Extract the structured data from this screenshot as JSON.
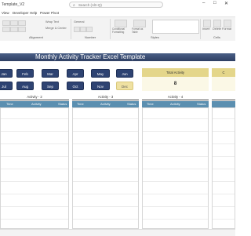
{
  "titlebar": {
    "file_title": "Template_V2",
    "search_placeholder": "Search (Alt+Q)",
    "minimize": "–",
    "maximize": "□",
    "close": "✕"
  },
  "menu": [
    "View",
    "Developer",
    "Help",
    "Power Pivot"
  ],
  "ribbon": {
    "groups": {
      "alignment": "Alignment",
      "number": "Number",
      "styles": "Styles",
      "cells": "Cells"
    },
    "wrap_text": "Wrap Text",
    "merge_center": "Merge & Center",
    "general": "General",
    "conditional_formatting": "Conditional Formatting",
    "format_as_table": "Format as Table",
    "cell_styles": "Cell Styles",
    "insert": "Insert",
    "delete": "Delete",
    "format": "Format"
  },
  "sheet": {
    "title": "Monthly Activity Tracker Excel Template",
    "months_row1": [
      "Jan",
      "Feb",
      "Mar",
      "Apr",
      "May",
      "Jun"
    ],
    "months_row2": [
      "Jul",
      "Aug",
      "Sep",
      "Oct",
      "Nov",
      "Dec"
    ],
    "active_month": "Dec",
    "total_activity_label": "Total Activity",
    "total_activity_value": "8",
    "right_label": "C",
    "activities": [
      {
        "title": "Activity - 2",
        "cols": [
          "Time",
          "Activity",
          "Status"
        ]
      },
      {
        "title": "Activity - 3",
        "cols": [
          "Time",
          "Activity",
          "Status"
        ]
      },
      {
        "title": "Activity - 4",
        "cols": [
          "Time",
          "Activity",
          "Status"
        ]
      }
    ]
  },
  "colors": {
    "header_band": "#3a4e78",
    "month_button": "#2e4372",
    "month_active": "#efe1a2",
    "total_head": "#e4d68a",
    "column_header": "#5b8fb0"
  }
}
